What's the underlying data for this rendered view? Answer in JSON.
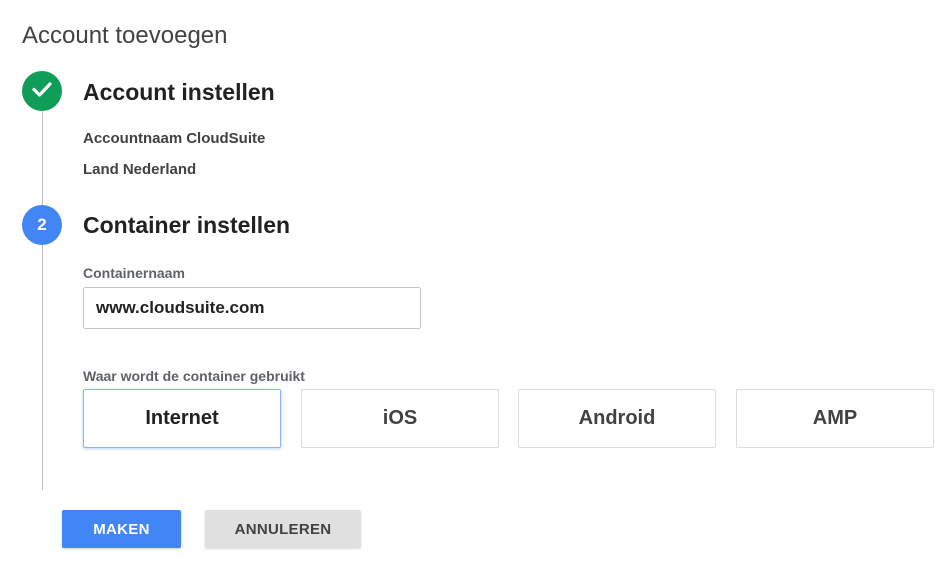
{
  "page": {
    "title": "Account toevoegen"
  },
  "step1": {
    "title": "Account instellen",
    "status_icon": "check-icon",
    "account_name_label": "Accountnaam",
    "account_name_value": "CloudSuite",
    "country_label": "Land",
    "country_value": "Nederland"
  },
  "step2": {
    "number": "2",
    "title": "Container instellen",
    "container_name_label": "Containernaam",
    "container_name_value": "www.cloudsuite.com",
    "usage_label": "Waar wordt de container gebruikt",
    "platforms": [
      "Internet",
      "iOS",
      "Android",
      "AMP"
    ],
    "selected_platform": "Internet"
  },
  "actions": {
    "create_label": "MAKEN",
    "cancel_label": "ANNULEREN"
  },
  "colors": {
    "accent": "#4285f4",
    "success": "#0f9d58"
  }
}
